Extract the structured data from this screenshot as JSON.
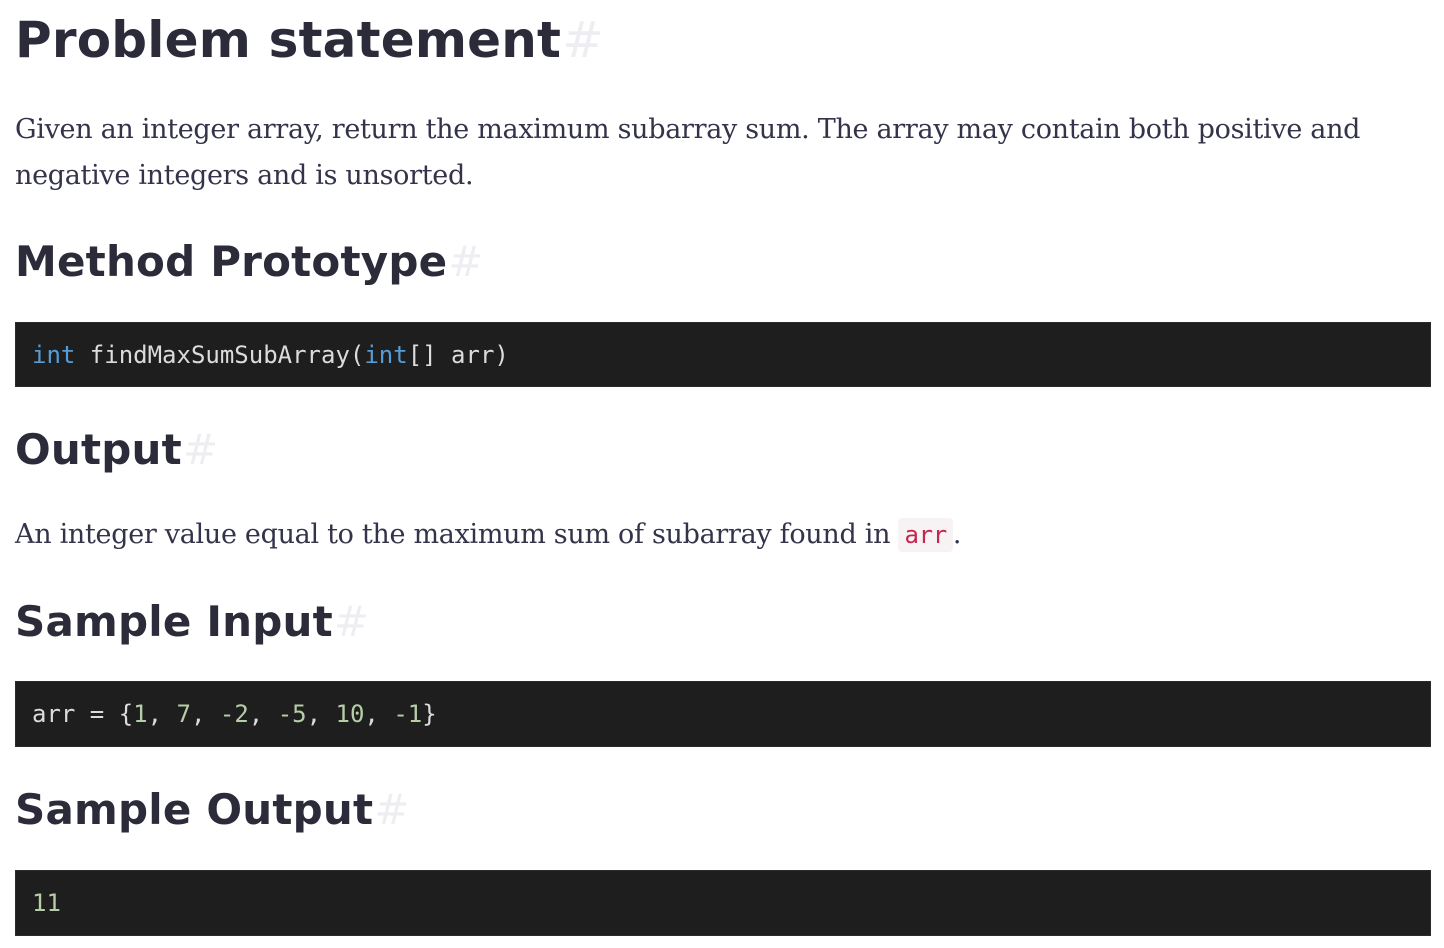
{
  "sections": {
    "problem": {
      "title": "Problem statement",
      "anchor": "#",
      "text": "Given an integer array, return the maximum subarray sum. The array may contain both positive and negative integers and is unsorted."
    },
    "prototype": {
      "title": "Method Prototype",
      "anchor": "#",
      "code": {
        "t1": "int",
        "t2": " findMaxSumSubArray(",
        "t3": "int",
        "t4": "[] arr)"
      }
    },
    "output": {
      "title": "Output",
      "anchor": "#",
      "text_before": "An integer value equal to the maximum sum of subarray found in ",
      "code": "arr",
      "text_after": "."
    },
    "sample_input": {
      "title": "Sample Input",
      "anchor": "#",
      "code": {
        "p1": "arr = {",
        "n1": "1",
        "s1": ", ",
        "n2": "7",
        "s2": ", ",
        "n3": "-2",
        "s3": ", ",
        "n4": "-5",
        "s4": ", ",
        "n5": "10",
        "s5": ", ",
        "n6": "-1",
        "p2": "}"
      }
    },
    "sample_output": {
      "title": "Sample Output",
      "anchor": "#",
      "code": "11"
    }
  },
  "colors": {
    "heading": "#2b2b3a",
    "body_text": "#33334a",
    "code_background": "#1e1e1e",
    "keyword": "#569cd6",
    "number": "#b5cea8",
    "inline_code": "#c7254e",
    "anchor": "#eeeef2"
  }
}
